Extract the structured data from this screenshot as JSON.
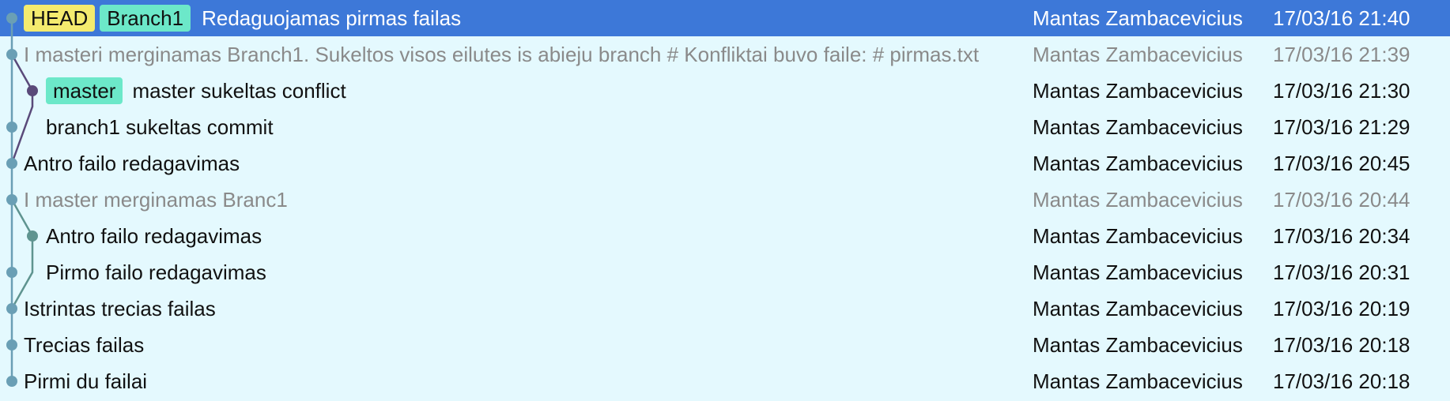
{
  "colors": {
    "background": "#e4f9fe",
    "selected_row": "#3d78d8",
    "merge_text": "#8a8a8a",
    "tag_head": "#f4eb6e",
    "tag_branch": "#6ce8c9",
    "lane_main": "#6a9fb5",
    "lane_master": "#5a4a7a",
    "lane_branch": "#5f9490"
  },
  "commits": [
    {
      "tags": [
        {
          "label": "HEAD",
          "kind": "head"
        },
        {
          "label": "Branch1",
          "kind": "branch"
        }
      ],
      "message": "Redaguojamas pirmas failas",
      "author": "Mantas Zambacevicius",
      "date": "17/03/16 21:40",
      "selected": true,
      "merge": false
    },
    {
      "tags": [],
      "message": "I masteri merginamas Branch1. Sukeltos visos eilutes is abieju branch # Konfliktai buvo faile: # pirmas.txt",
      "author": "Mantas Zambacevicius",
      "date": "17/03/16 21:39",
      "selected": false,
      "merge": true
    },
    {
      "tags": [
        {
          "label": "master",
          "kind": "branch"
        }
      ],
      "message": "master sukeltas conflict",
      "author": "Mantas Zambacevicius",
      "date": "17/03/16 21:30",
      "selected": false,
      "merge": false
    },
    {
      "tags": [],
      "message": "branch1 sukeltas commit",
      "author": "Mantas Zambacevicius",
      "date": "17/03/16 21:29",
      "selected": false,
      "merge": false
    },
    {
      "tags": [],
      "message": "Antro failo redagavimas",
      "author": "Mantas Zambacevicius",
      "date": "17/03/16 20:45",
      "selected": false,
      "merge": false
    },
    {
      "tags": [],
      "message": "I master merginamas Branc1",
      "author": "Mantas Zambacevicius",
      "date": "17/03/16 20:44",
      "selected": false,
      "merge": true
    },
    {
      "tags": [],
      "message": "Antro failo redagavimas",
      "author": "Mantas Zambacevicius",
      "date": "17/03/16 20:34",
      "selected": false,
      "merge": false
    },
    {
      "tags": [],
      "message": "Pirmo failo redagavimas",
      "author": "Mantas Zambacevicius",
      "date": "17/03/16 20:31",
      "selected": false,
      "merge": false
    },
    {
      "tags": [],
      "message": "Istrintas trecias failas",
      "author": "Mantas Zambacevicius",
      "date": "17/03/16 20:19",
      "selected": false,
      "merge": false
    },
    {
      "tags": [],
      "message": "Trecias failas",
      "author": "Mantas Zambacevicius",
      "date": "17/03/16 20:18",
      "selected": false,
      "merge": false
    },
    {
      "tags": [],
      "message": "Pirmi du failai",
      "author": "Mantas Zambacevicius",
      "date": "17/03/16 20:18",
      "selected": false,
      "merge": false
    }
  ]
}
